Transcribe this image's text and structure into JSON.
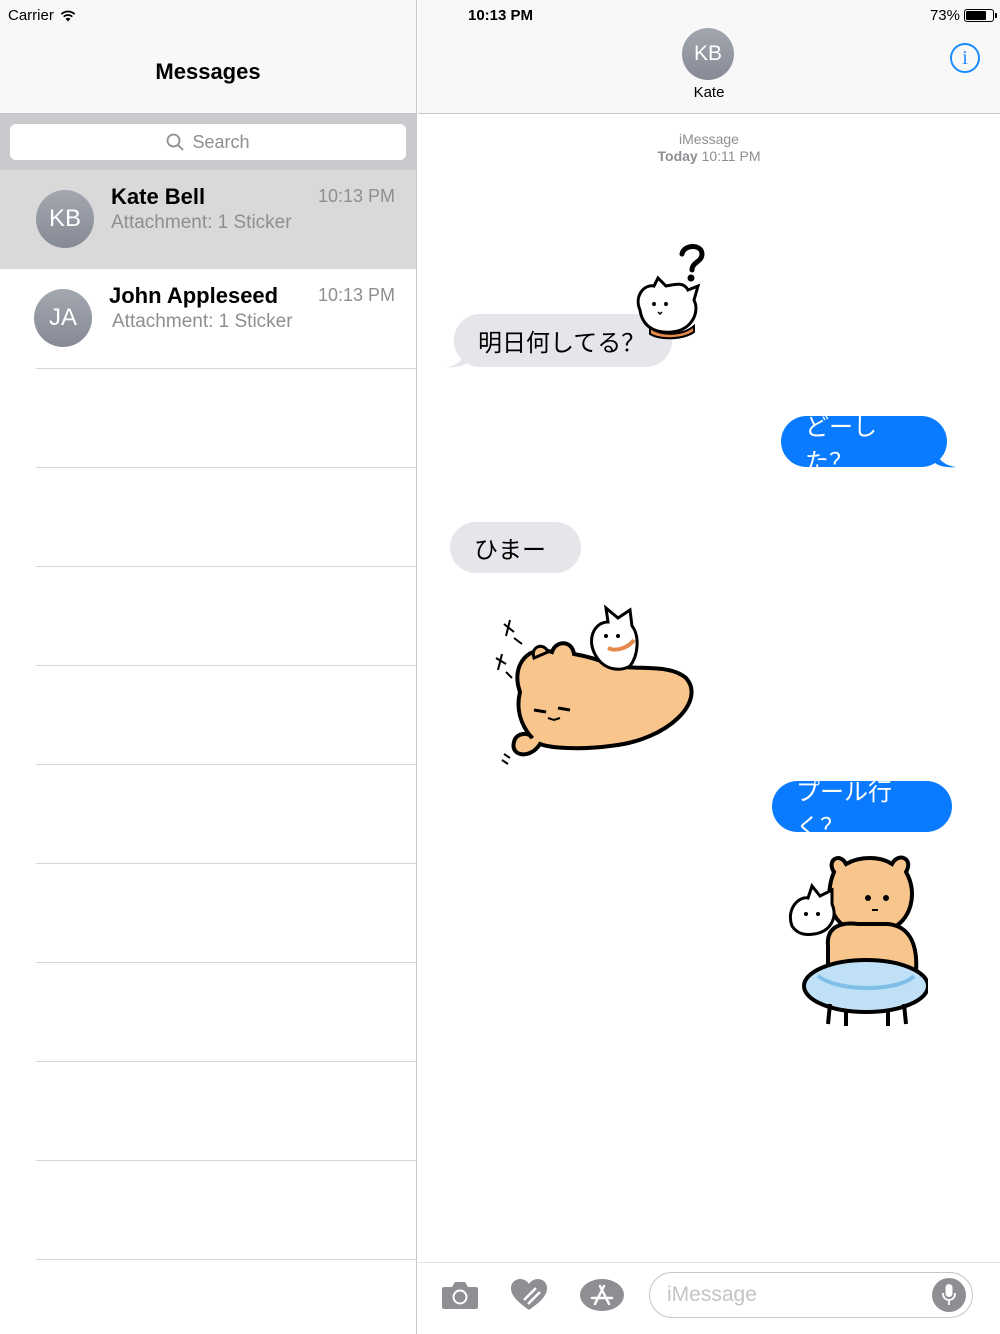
{
  "status": {
    "carrier": "Carrier",
    "time": "10:13 PM",
    "battery": "73%",
    "battery_level": 0.73
  },
  "list": {
    "title": "Messages",
    "search_placeholder": "Search",
    "conversations": [
      {
        "initials": "KB",
        "name": "Kate Bell",
        "preview": "Attachment: 1 Sticker",
        "time": "10:13 PM",
        "selected": true
      },
      {
        "initials": "JA",
        "name": "John Appleseed",
        "preview": "Attachment: 1 Sticker",
        "time": "10:13 PM",
        "selected": false
      }
    ]
  },
  "chat": {
    "contact_initials": "KB",
    "contact_name": "Kate",
    "info_icon": "info-icon",
    "service": "iMessage",
    "date_label": "Today",
    "date_time": "10:11 PM",
    "messages": [
      {
        "dir": "in",
        "text": "明日何してる？"
      },
      {
        "dir": "out",
        "text": "どーした？"
      },
      {
        "dir": "in",
        "text": "ひまー"
      },
      {
        "dir": "out",
        "text": "プール行く？"
      }
    ],
    "stickers": [
      "cat-question-sticker",
      "bear-cat-lying-sticker",
      "bear-swim-ring-sticker"
    ],
    "input_placeholder": "iMessage",
    "icons": [
      "camera-icon",
      "digital-touch-icon",
      "app-store-icon",
      "microphone-icon"
    ]
  },
  "colors": {
    "outgoing": "#0a7bff",
    "incoming": "#e5e5ea",
    "accent": "#1a8cff",
    "sticker_bear": "#f8c58c"
  }
}
